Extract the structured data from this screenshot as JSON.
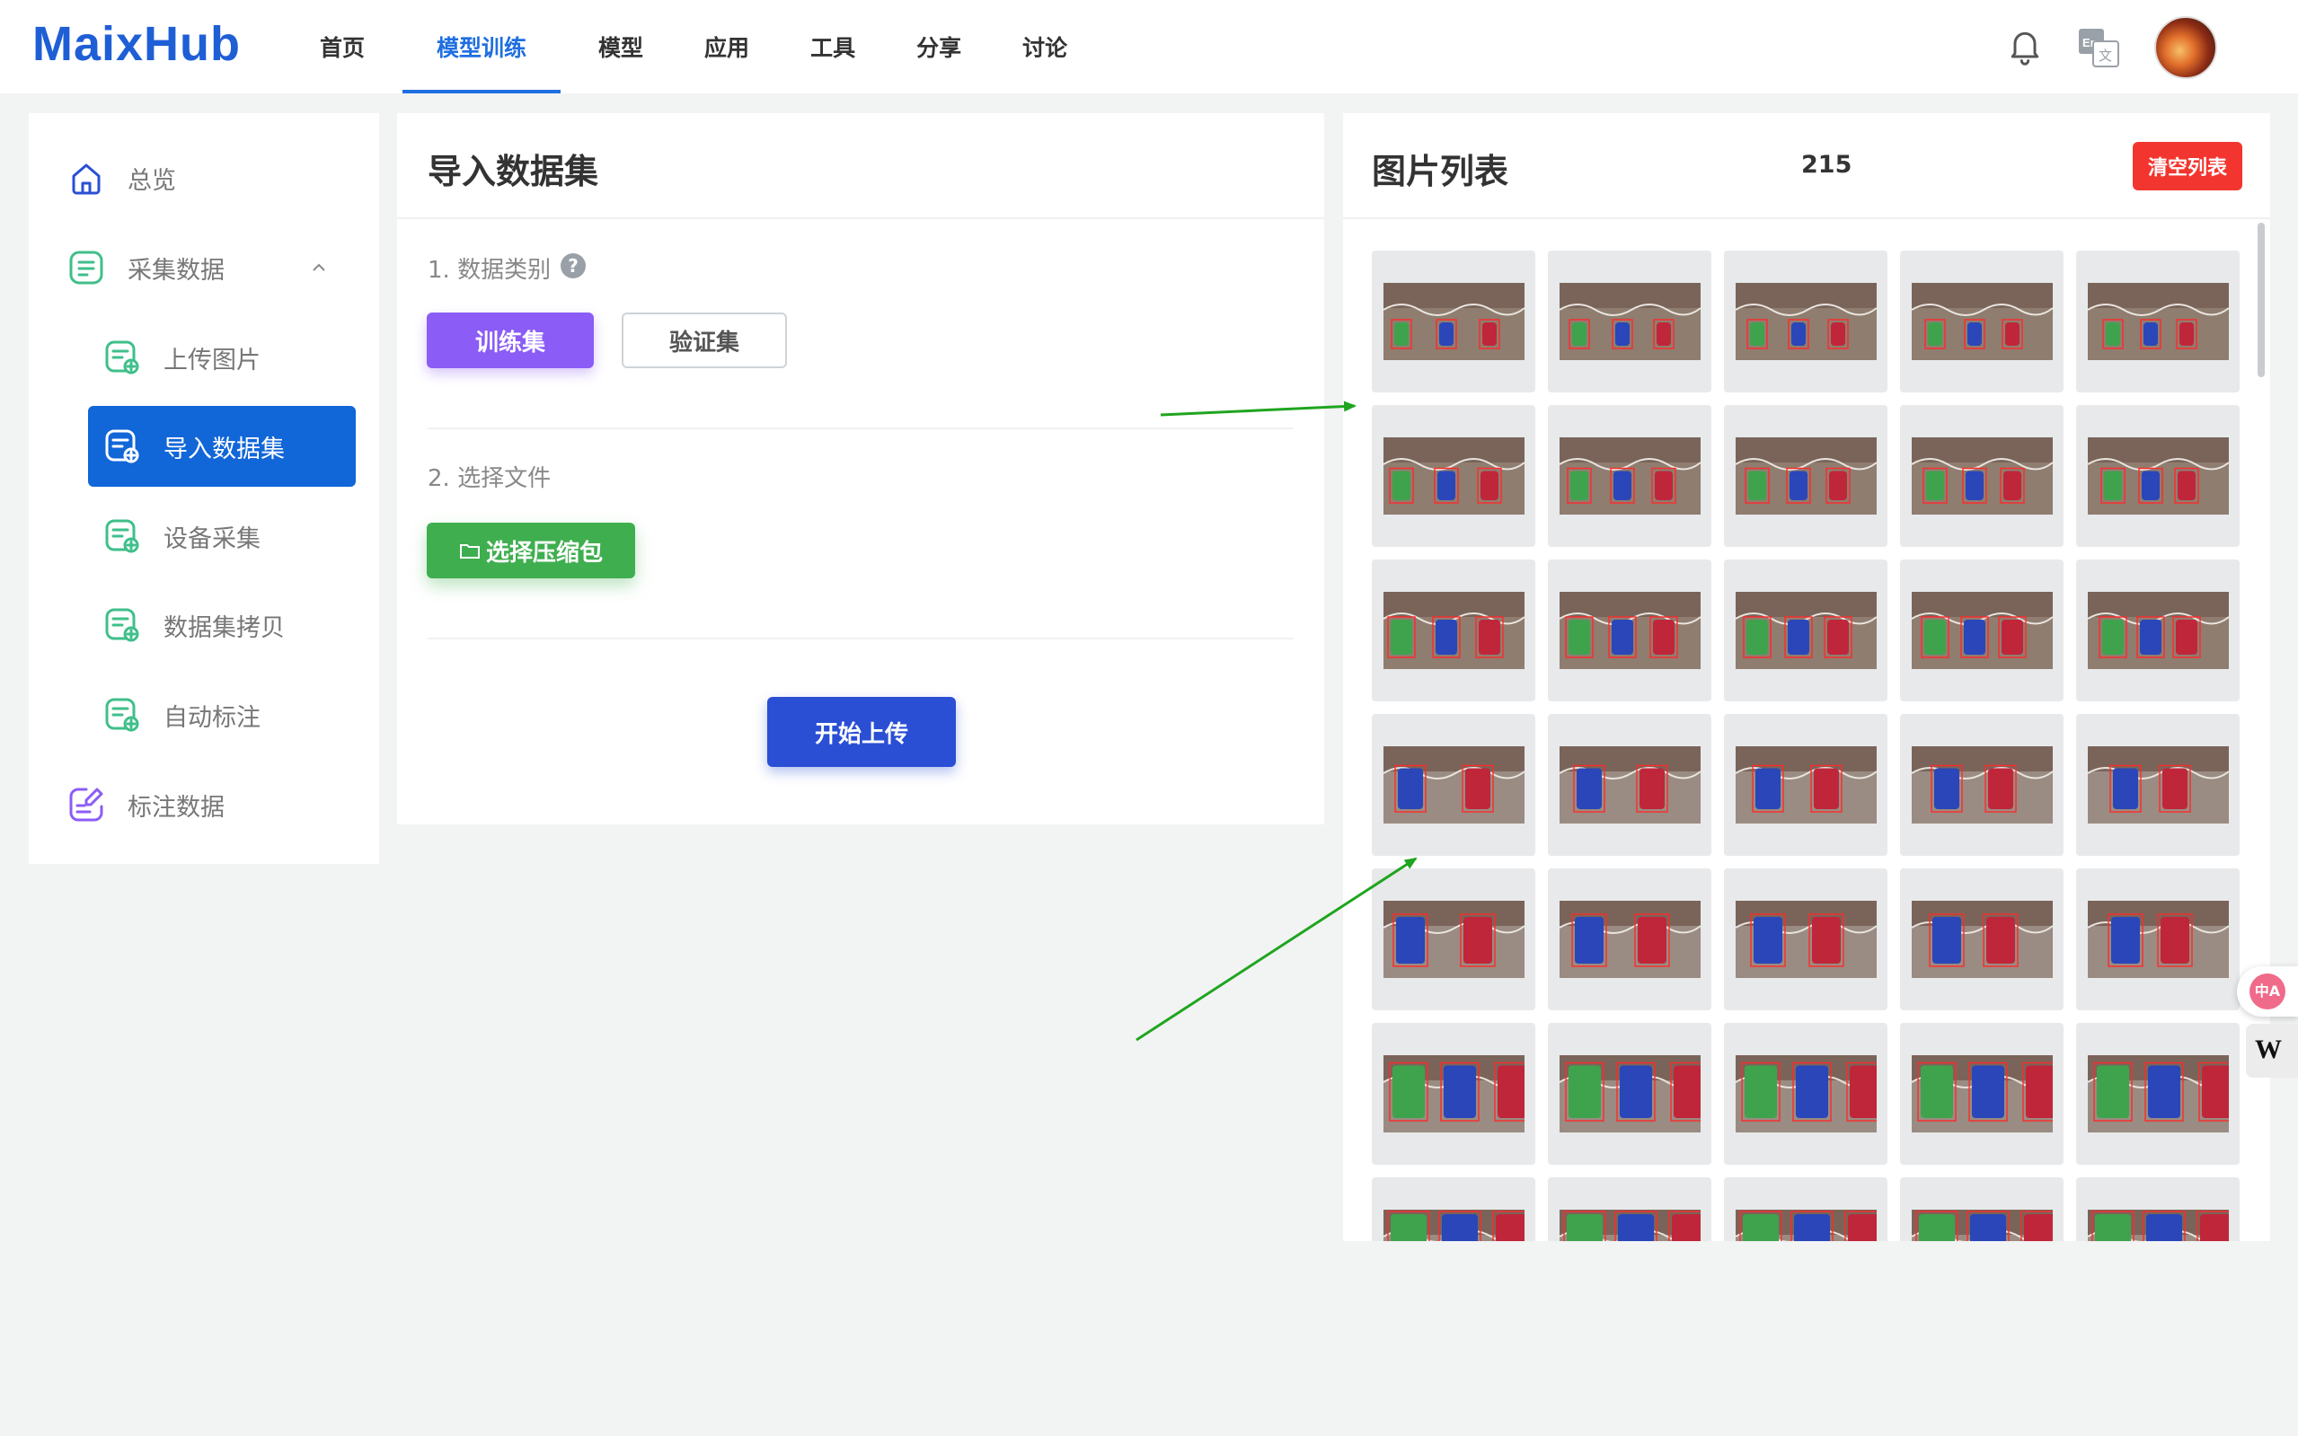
{
  "brand": {
    "logo": "MaixHub"
  },
  "nav": {
    "items": [
      {
        "label": "首页"
      },
      {
        "label": "模型训练",
        "active": true
      },
      {
        "label": "模型"
      },
      {
        "label": "应用"
      },
      {
        "label": "工具"
      },
      {
        "label": "分享"
      },
      {
        "label": "讨论"
      }
    ],
    "icons": [
      "bell-icon",
      "language-icon",
      "avatar"
    ]
  },
  "sidebar": {
    "items": [
      {
        "label": "总览",
        "icon": "home-icon"
      },
      {
        "label": "采集数据",
        "icon": "collect-icon",
        "expanded": true
      },
      {
        "label": "上传图片",
        "icon": "upload-image-icon"
      },
      {
        "label": "导入数据集",
        "icon": "import-dataset-icon",
        "active": true
      },
      {
        "label": "设备采集",
        "icon": "device-collect-icon"
      },
      {
        "label": "数据集拷贝",
        "icon": "dataset-copy-icon"
      },
      {
        "label": "自动标注",
        "icon": "auto-label-icon"
      },
      {
        "label": "标注数据",
        "icon": "label-data-icon"
      }
    ]
  },
  "import": {
    "title": "导入数据集",
    "step1_label": "1. 数据类别",
    "help_glyph": "?",
    "train_button": "训练集",
    "val_button": "验证集",
    "selected_category": "训练集",
    "step2_label": "2. 选择文件",
    "choose_zip_button": "选择压缩包",
    "start_upload_button": "开始上传"
  },
  "images": {
    "title": "图片列表",
    "count": "215",
    "clear_button": "清空列表"
  },
  "floating": {
    "translate_glyph": "中A",
    "w_glyph": "W"
  },
  "colors": {
    "brand_blue": "#1f5fd6",
    "nav_active": "#1f6fe0",
    "sidebar_active": "#1166d8",
    "train_purple": "#8b5cf6",
    "zip_green": "#3fae4f",
    "upload_blue": "#2a4fd4",
    "clear_red": "#f2362f",
    "annotation_arrow": "#1fa51f"
  }
}
